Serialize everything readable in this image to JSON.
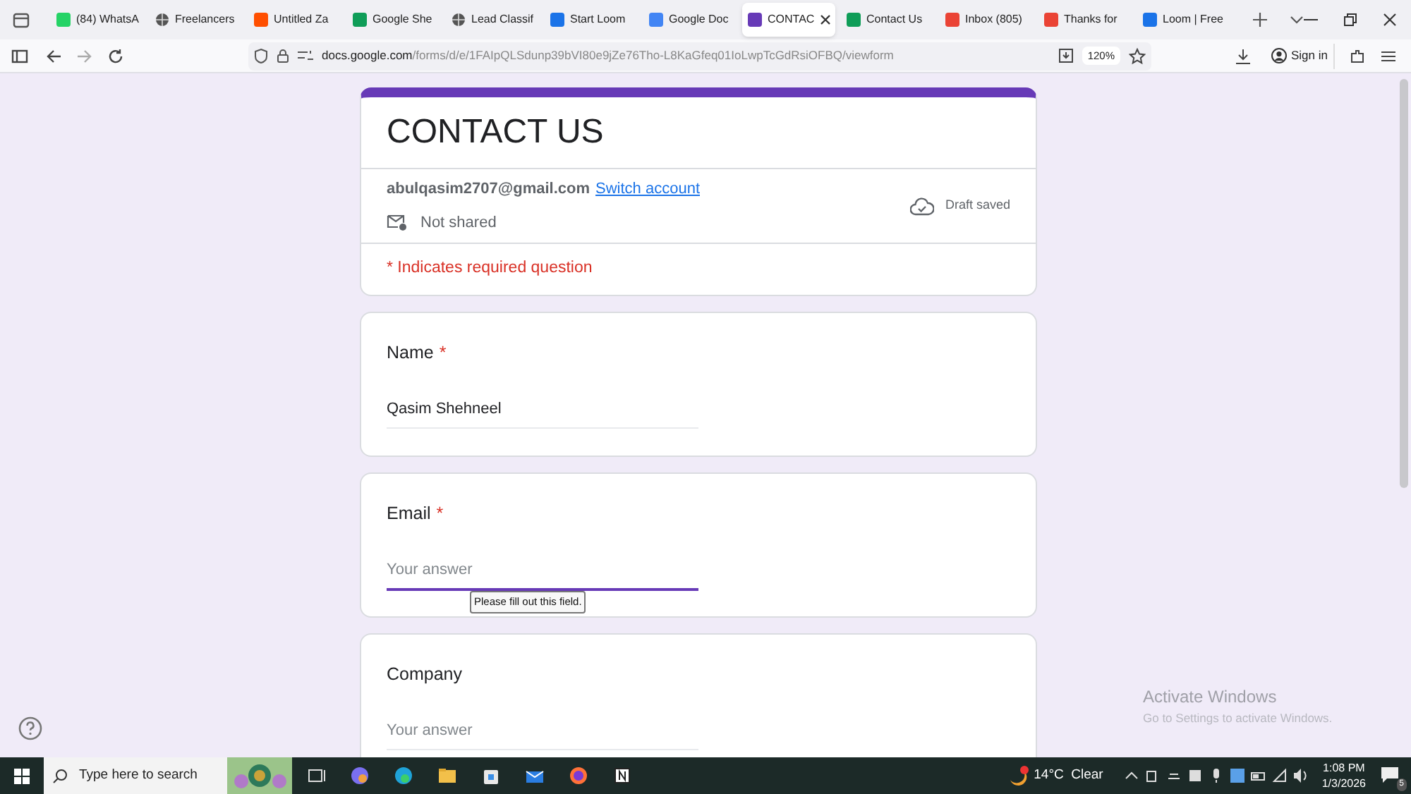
{
  "tabs": [
    {
      "title": "(84) WhatsA",
      "kind": "favicon",
      "color": "#25d366",
      "selected": false
    },
    {
      "title": "Freelancers",
      "kind": "globe",
      "color": "#555555",
      "selected": false
    },
    {
      "title": "Untitled Za",
      "kind": "favicon",
      "color": "#ff4f00",
      "selected": false
    },
    {
      "title": "Google She",
      "kind": "favicon",
      "color": "#0f9d58",
      "selected": false
    },
    {
      "title": "Lead Classif",
      "kind": "globe",
      "color": "#555555",
      "selected": false
    },
    {
      "title": "Start Loom",
      "kind": "favicon",
      "color": "#1a73e8",
      "selected": false
    },
    {
      "title": "Google Doc",
      "kind": "favicon",
      "color": "#4285f4",
      "selected": false
    },
    {
      "title": "CONTAC",
      "kind": "favicon",
      "color": "#673ab7",
      "selected": true
    },
    {
      "title": "Contact Us",
      "kind": "favicon",
      "color": "#0f9d58",
      "selected": false
    },
    {
      "title": "Inbox (805)",
      "kind": "favicon",
      "color": "#ea4335",
      "selected": false
    },
    {
      "title": "Thanks for",
      "kind": "favicon",
      "color": "#ea4335",
      "selected": false
    },
    {
      "title": "Loom | Free",
      "kind": "favicon",
      "color": "#1a73e8",
      "selected": false
    }
  ],
  "address_bar": {
    "url_host": "docs.google.com",
    "url_path": "/forms/d/e/1FAIpQLSdunp39bVI80e9jZe76Tho-L8KaGfeq01IoLwpTcGdRsiOFBQ/viewform",
    "zoom": "120%",
    "sign_in": "Sign in"
  },
  "form": {
    "title": "CONTACT US",
    "account": "abulqasim2707@gmail.com",
    "switch_account": "Switch account",
    "sharing": "Not shared",
    "draft_status": "Draft saved",
    "required_note": "* Indicates required question",
    "required_mark": "*",
    "questions": [
      {
        "label": "Name",
        "required": true,
        "value": "Qasim Shehneel",
        "focused": false
      },
      {
        "label": "Email",
        "required": true,
        "placeholder": "Your answer",
        "focused": true,
        "tooltip": "Please fill out this field."
      },
      {
        "label": "Company",
        "required": false,
        "placeholder": "Your answer",
        "focused": false
      }
    ]
  },
  "activation_notice": {
    "title": "Activate Windows",
    "message": "Go to Settings to activate Windows."
  },
  "taskbar": {
    "search_placeholder": "Type here to search",
    "weather": "14°C  Clear",
    "time": "1:08 PM",
    "date": "1/3/2026",
    "notifications": "5"
  }
}
